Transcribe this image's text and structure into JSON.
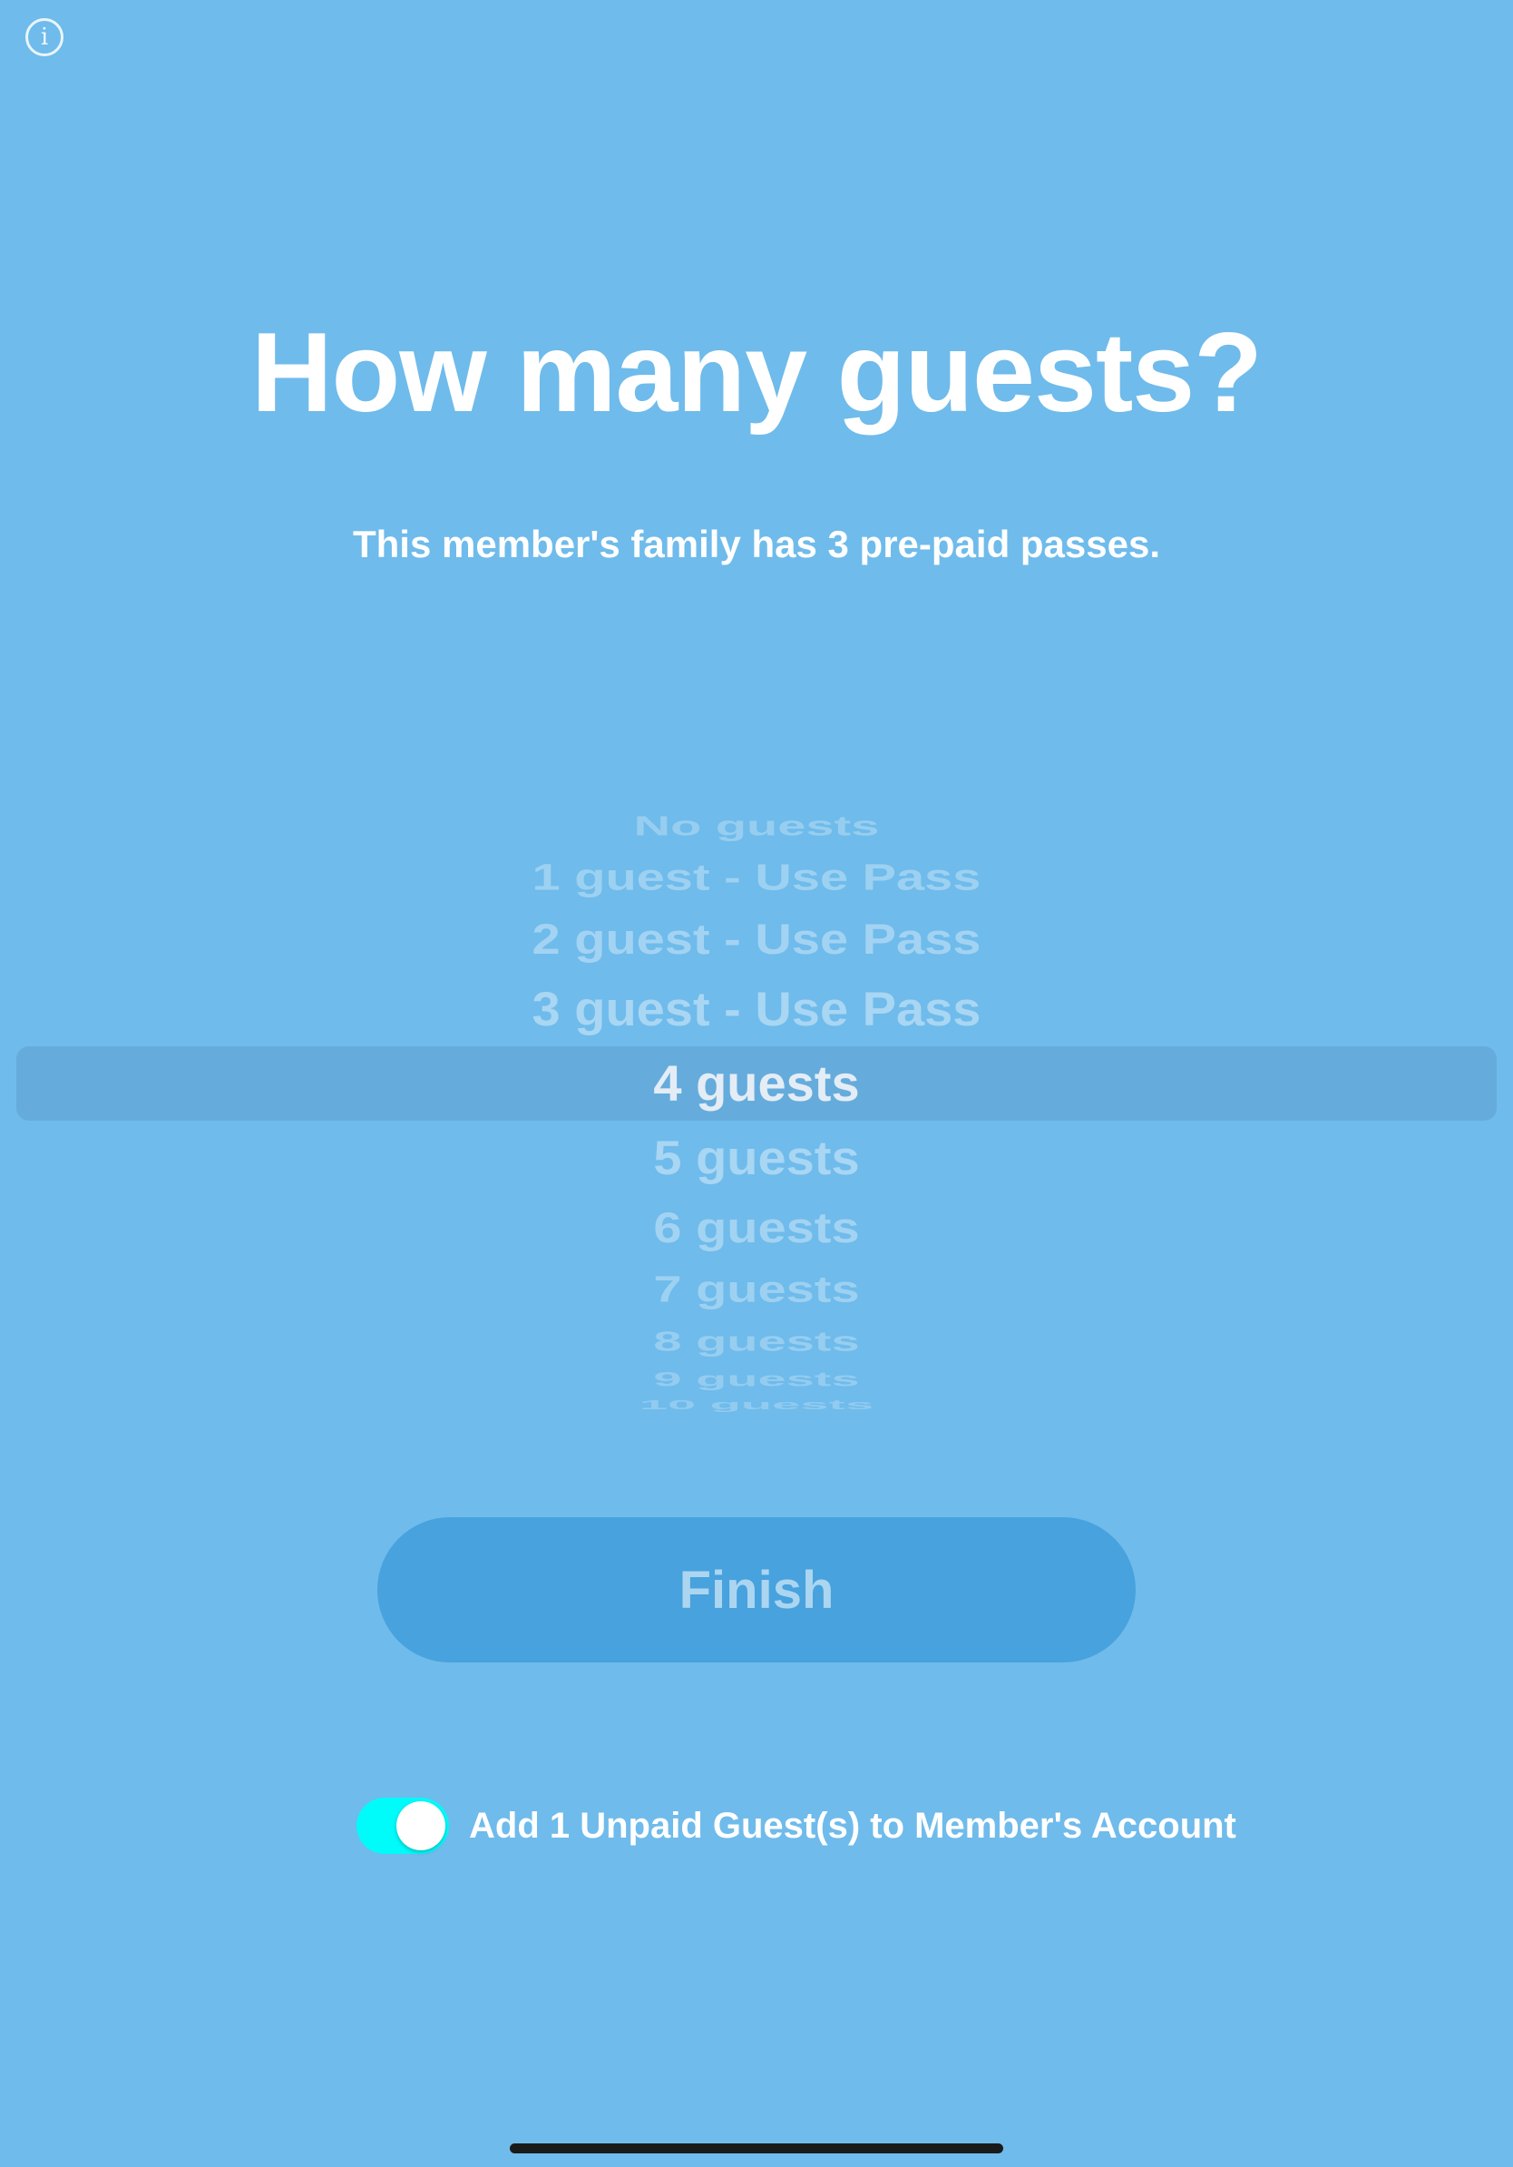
{
  "info_icon": {
    "glyph": "i",
    "icon": "info-icon"
  },
  "title": "How many guests?",
  "subtitle": "This member's family has 3 pre-paid passes.",
  "picker": {
    "selected_index": 4,
    "options": [
      "No guests",
      "1 guest - Use Pass",
      "2 guest - Use Pass",
      "3 guest - Use Pass",
      "4 guests",
      "5 guests",
      "6 guests",
      "7 guests",
      "8 guests",
      "9 guests",
      "10 guests"
    ]
  },
  "finish_button": {
    "label": "Finish"
  },
  "unpaid_toggle": {
    "on": true,
    "label": "Add 1 Unpaid Guest(s) to Member's Account"
  },
  "colors": {
    "background": "#6fbbeb",
    "button": "#47a2de",
    "toggle_on": "#00fbfb"
  }
}
